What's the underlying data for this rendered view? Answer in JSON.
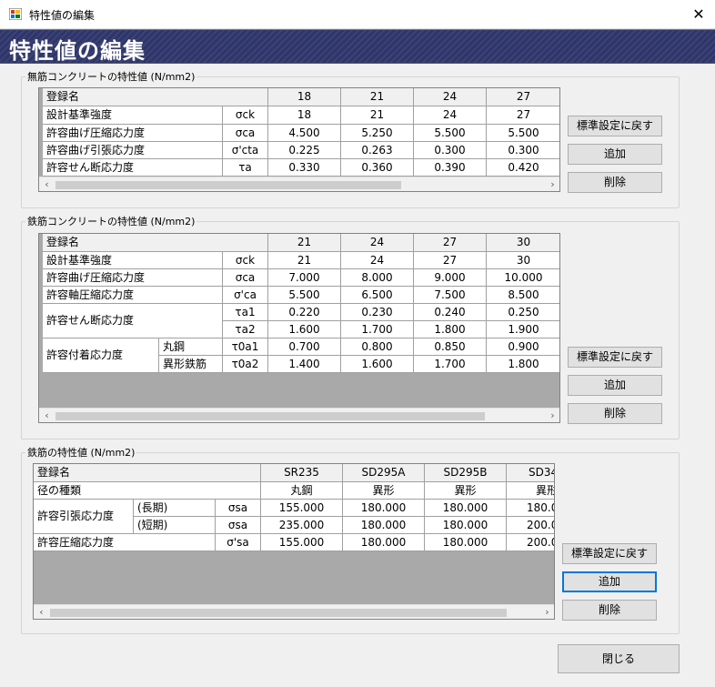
{
  "window": {
    "title": "特性値の編集",
    "banner": "特性値の編集",
    "close_glyph": "✕"
  },
  "scroll": {
    "left": "‹",
    "right": "›"
  },
  "plain_group": {
    "label": "無筋コンクリートの特性値 (N/mm2)",
    "header_label": "登録名",
    "columns": [
      "18",
      "21",
      "24",
      "27"
    ],
    "rows": [
      {
        "label": "設計基準強度",
        "symbol": "σck",
        "values": [
          "18",
          "21",
          "24",
          "27"
        ]
      },
      {
        "label": "許容曲げ圧縮応力度",
        "symbol": "σca",
        "values": [
          "4.500",
          "5.250",
          "5.500",
          "5.500"
        ]
      },
      {
        "label": "許容曲げ引張応力度",
        "symbol": "σ'cta",
        "values": [
          "0.225",
          "0.263",
          "0.300",
          "0.300"
        ]
      },
      {
        "label": "許容せん断応力度",
        "symbol": "τa",
        "values": [
          "0.330",
          "0.360",
          "0.390",
          "0.420"
        ]
      }
    ],
    "buttons": {
      "reset": "標準設定に戻す",
      "add": "追加",
      "delete": "削除"
    }
  },
  "rc_group": {
    "label": "鉄筋コンクリートの特性値 (N/mm2)",
    "header_label": "登録名",
    "columns": [
      "21",
      "24",
      "27",
      "30"
    ],
    "rows": [
      {
        "label": "設計基準強度",
        "symbol": "σck",
        "values": [
          "21",
          "24",
          "27",
          "30"
        ]
      },
      {
        "label": "許容曲げ圧縮応力度",
        "symbol": "σca",
        "values": [
          "7.000",
          "8.000",
          "9.000",
          "10.000"
        ]
      },
      {
        "label": "許容軸圧縮応力度",
        "symbol": "σ'ca",
        "values": [
          "5.500",
          "6.500",
          "7.500",
          "8.500"
        ]
      }
    ],
    "shear": {
      "label": "許容せん断応力度",
      "rows": [
        {
          "symbol": "τa1",
          "values": [
            "0.220",
            "0.230",
            "0.240",
            "0.250"
          ]
        },
        {
          "symbol": "τa2",
          "values": [
            "1.600",
            "1.700",
            "1.800",
            "1.900"
          ]
        }
      ]
    },
    "bond": {
      "label": "許容付着応力度",
      "rows": [
        {
          "sub": "丸鋼",
          "symbol": "τ0a1",
          "values": [
            "0.700",
            "0.800",
            "0.850",
            "0.900"
          ]
        },
        {
          "sub": "異形鉄筋",
          "symbol": "τ0a2",
          "values": [
            "1.400",
            "1.600",
            "1.700",
            "1.800"
          ]
        }
      ]
    },
    "buttons": {
      "reset": "標準設定に戻す",
      "add": "追加",
      "delete": "削除"
    }
  },
  "rebar_group": {
    "label": "鉄筋の特性値 (N/mm2)",
    "header_label": "登録名",
    "columns": [
      "SR235",
      "SD295A",
      "SD295B",
      "SD34"
    ],
    "type_label": "径の種類",
    "types": [
      "丸鋼",
      "異形",
      "異形",
      "異形"
    ],
    "tension": {
      "label": "許容引張応力度",
      "rows": [
        {
          "sub": "(長期)",
          "symbol": "σsa",
          "values": [
            "155.000",
            "180.000",
            "180.000",
            "180.0"
          ]
        },
        {
          "sub": "(短期)",
          "symbol": "σsa",
          "values": [
            "235.000",
            "180.000",
            "180.000",
            "200.0"
          ]
        }
      ]
    },
    "compression": {
      "label": "許容圧縮応力度",
      "symbol": "σ'sa",
      "values": [
        "155.000",
        "180.000",
        "180.000",
        "200.0"
      ]
    },
    "buttons": {
      "reset": "標準設定に戻す",
      "add": "追加",
      "delete": "削除"
    }
  },
  "footer": {
    "close": "閉じる"
  }
}
